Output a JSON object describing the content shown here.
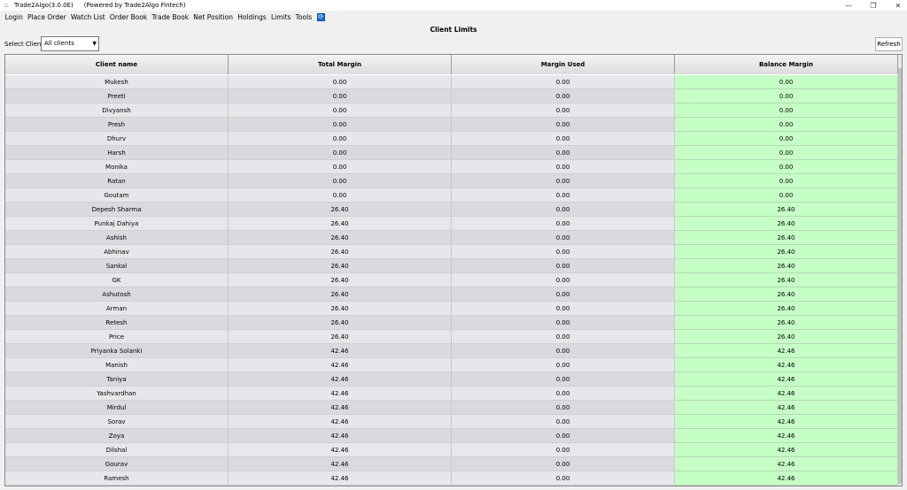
{
  "window": {
    "title": "Trade2Algo(3.0.0E)",
    "powered": "(Powered by Trade2Algo Fintech)",
    "minimize": "—",
    "restore": "❐",
    "close": "✕",
    "app_icon": "java-cup-icon"
  },
  "menu": [
    "Login",
    "Place Order",
    "Watch List",
    "Order Book",
    "Trade Book",
    "Net Position",
    "Holdings",
    "Limits",
    "Tools"
  ],
  "menu_icon": "refresh-icon",
  "panel": {
    "title": "Client Limits",
    "select_label": "Select Client:",
    "select_value": "All clients",
    "refresh_label": "Refresh"
  },
  "table": {
    "columns": [
      "Client name",
      "Total Margin",
      "Margin Used",
      "Balance Margin"
    ],
    "rows": [
      [
        "Mukesh",
        "0.00",
        "0.00",
        "0.00"
      ],
      [
        "Preeti",
        "0.00",
        "0.00",
        "0.00"
      ],
      [
        "Divyansh",
        "0.00",
        "0.00",
        "0.00"
      ],
      [
        "Presh",
        "0.00",
        "0.00",
        "0.00"
      ],
      [
        "Dhurv",
        "0.00",
        "0.00",
        "0.00"
      ],
      [
        "Harsh",
        "0.00",
        "0.00",
        "0.00"
      ],
      [
        "Monika",
        "0.00",
        "0.00",
        "0.00"
      ],
      [
        "Ratan",
        "0.00",
        "0.00",
        "0.00"
      ],
      [
        "Goutam",
        "0.00",
        "0.00",
        "0.00"
      ],
      [
        "Depesh Sharma",
        "26.40",
        "0.00",
        "26.40"
      ],
      [
        "Punkaj Dahiya",
        "26.40",
        "0.00",
        "26.40"
      ],
      [
        "Ashish",
        "26.40",
        "0.00",
        "26.40"
      ],
      [
        "Abhinav",
        "26.40",
        "0.00",
        "26.40"
      ],
      [
        "Sankal",
        "26.40",
        "0.00",
        "26.40"
      ],
      [
        "GK",
        "26.40",
        "0.00",
        "26.40"
      ],
      [
        "Ashutosh",
        "26.40",
        "0.00",
        "26.40"
      ],
      [
        "Arman",
        "26.40",
        "0.00",
        "26.40"
      ],
      [
        "Retesh",
        "26.40",
        "0.00",
        "26.40"
      ],
      [
        "Price",
        "26.40",
        "0.00",
        "26.40"
      ],
      [
        "Priyanka Solanki",
        "42.46",
        "0.00",
        "42.46"
      ],
      [
        "Manish",
        "42.46",
        "0.00",
        "42.46"
      ],
      [
        "Taniya",
        "42.46",
        "0.00",
        "42.46"
      ],
      [
        "Yashvardhan",
        "42.46",
        "0.00",
        "42.46"
      ],
      [
        "Mirdul",
        "42.46",
        "0.00",
        "42.46"
      ],
      [
        "Sorav",
        "42.46",
        "0.00",
        "42.46"
      ],
      [
        "Zoya",
        "42.46",
        "0.00",
        "42.46"
      ],
      [
        "Dilshal",
        "42.46",
        "0.00",
        "42.46"
      ],
      [
        "Gourav",
        "42.46",
        "0.00",
        "42.46"
      ],
      [
        "Ramesh",
        "42.46",
        "0.00",
        "42.46"
      ]
    ]
  },
  "colors": {
    "balance_bg": "#c6ffc6",
    "row_odd": "#e6e7ea",
    "row_even": "#d8dade"
  }
}
